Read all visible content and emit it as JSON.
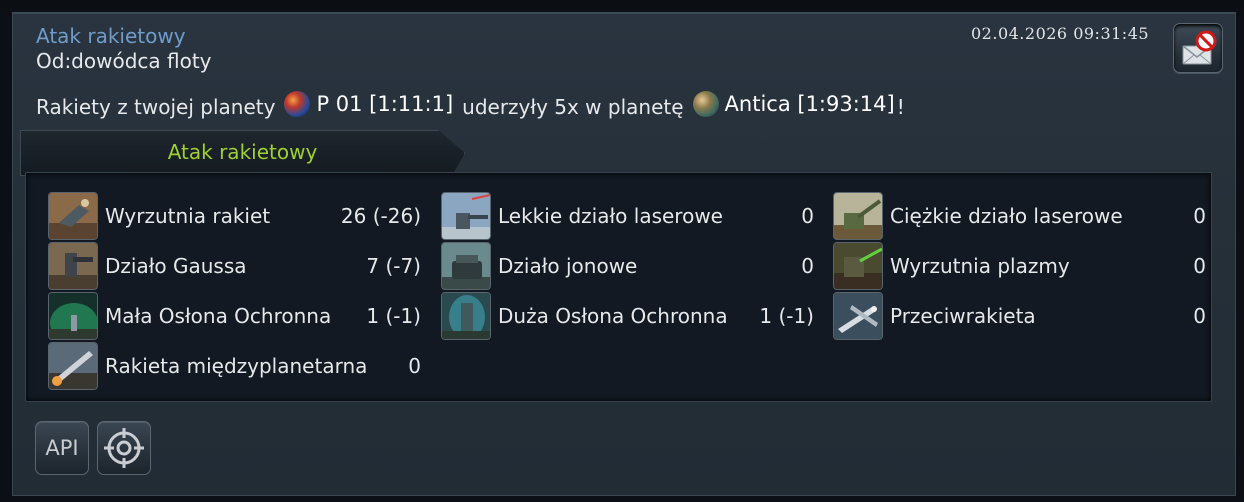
{
  "message": {
    "subject": "Atak rakietowy",
    "from": "Od:dowódca floty",
    "datetime": "02.04.2026 09:31:45",
    "delete_icon": "mail-delete-icon"
  },
  "summary": {
    "text_before": "Rakiety z twojej planety",
    "attacker_planet": "P 01 [1:11:1]",
    "text_middle": "uderzyły 5x w planetę",
    "target_planet": "Antica [1:93:14]",
    "text_end": "!"
  },
  "tab": {
    "label": "Atak rakietowy",
    "color": "#9fd12c"
  },
  "defenses": {
    "col1": [
      {
        "name": "Wyrzutnia rakiet",
        "value": "26 (-26)"
      },
      {
        "name": "Działo Gaussa",
        "value": "7 (-7)"
      },
      {
        "name": "Mała Osłona Ochronna",
        "value": "1 (-1)"
      },
      {
        "name": "Rakieta międzyplanetarna",
        "value": "0"
      }
    ],
    "col2": [
      {
        "name": "Lekkie działo laserowe",
        "value": "0"
      },
      {
        "name": "Działo jonowe",
        "value": "0"
      },
      {
        "name": "Duża Osłona Ochronna",
        "value": "1 (-1)"
      }
    ],
    "col3": [
      {
        "name": "Ciężkie działo laserowe",
        "value": "0"
      },
      {
        "name": "Wyrzutnia plazmy",
        "value": "0"
      },
      {
        "name": "Przeciwrakieta",
        "value": "0"
      }
    ]
  },
  "footer": {
    "api_label": "API",
    "target_icon": "crosshair-icon"
  }
}
